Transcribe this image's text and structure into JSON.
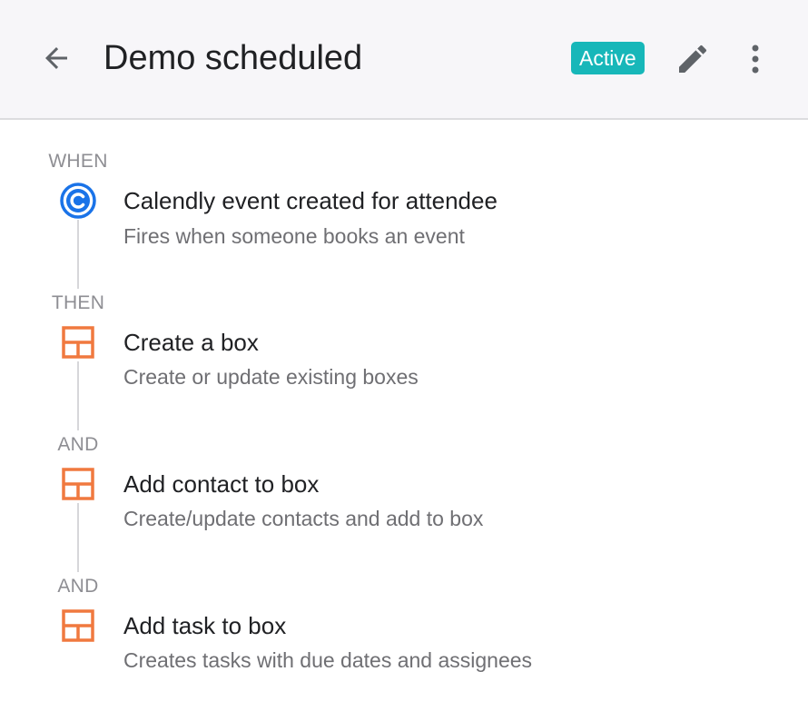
{
  "header": {
    "title": "Demo scheduled",
    "status": "Active",
    "status_color": "#17b7b9"
  },
  "steps": [
    {
      "label": "WHEN",
      "icon": "calendly-icon",
      "title": "Calendly event created for attendee",
      "description": "Fires when someone books an event"
    },
    {
      "label": "THEN",
      "icon": "box-icon",
      "title": "Create a box",
      "description": "Create or update existing boxes"
    },
    {
      "label": "AND",
      "icon": "box-icon",
      "title": "Add contact to box",
      "description": "Create/update contacts and add to box"
    },
    {
      "label": "AND",
      "icon": "box-icon",
      "title": "Add task to box",
      "description": "Creates tasks with due dates and assignees"
    }
  ]
}
